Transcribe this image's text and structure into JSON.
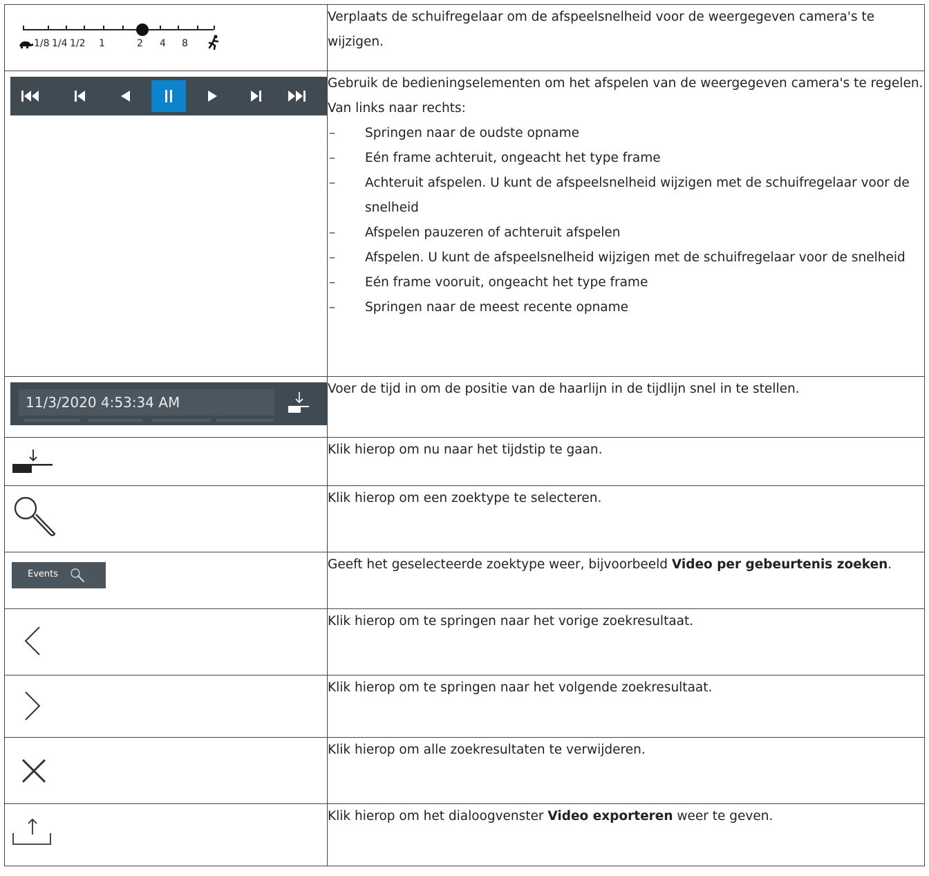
{
  "speed_slider": {
    "labels": [
      "1/8",
      "1/4",
      "1/2",
      "1",
      "2",
      "4",
      "8"
    ],
    "value": "2"
  },
  "playback_controls": {
    "active": "pause"
  },
  "time_input": {
    "value": "11/3/2020 4:53:34 AM"
  },
  "events_button": {
    "label": "Events"
  },
  "rows": {
    "speed": {
      "text": "Verplaats de schuifregelaar om de afspeelsnelheid voor de weergegeven camera's te wijzigen."
    },
    "controls": {
      "line1": "Gebruik de bedieningselementen om het afspelen van de weergegeven camera's te regelen.",
      "line2": "Van links naar rechts:",
      "items": [
        "Springen naar de oudste opname",
        "Eén frame achteruit, ongeacht het type frame",
        "Achteruit afspelen. U kunt de afspeelsnelheid wijzigen met de schuifregelaar voor de snelheid",
        "Afspelen pauzeren of achteruit afspelen",
        "Afspelen. U kunt de afspeelsnelheid wijzigen met de schuifregelaar voor de snelheid",
        "Eén frame vooruit, ongeacht het type frame",
        "Springen naar de meest recente opname"
      ]
    },
    "time": {
      "text": "Voer de tijd in om de positie van de haarlijn in de tijdlijn snel in te stellen."
    },
    "goto": {
      "text": "Klik hierop om nu naar het tijdstip te gaan."
    },
    "search": {
      "text": "Klik hierop om een zoektype te selecteren."
    },
    "type": {
      "prefix": "Geeft het geselecteerde zoektype weer, bijvoorbeeld ",
      "bold": "Video per gebeurtenis zoeken",
      "suffix": "."
    },
    "prev": {
      "text": "Klik hierop om te springen naar het vorige zoekresultaat."
    },
    "next": {
      "text": "Klik hierop om te springen naar het volgende zoekresultaat."
    },
    "clear": {
      "text": "Klik hierop om alle zoekresultaten te verwijderen."
    },
    "export": {
      "prefix": "Klik hierop om het dialoogvenster ",
      "bold": "Video exporteren",
      "suffix": " weer te geven."
    }
  }
}
